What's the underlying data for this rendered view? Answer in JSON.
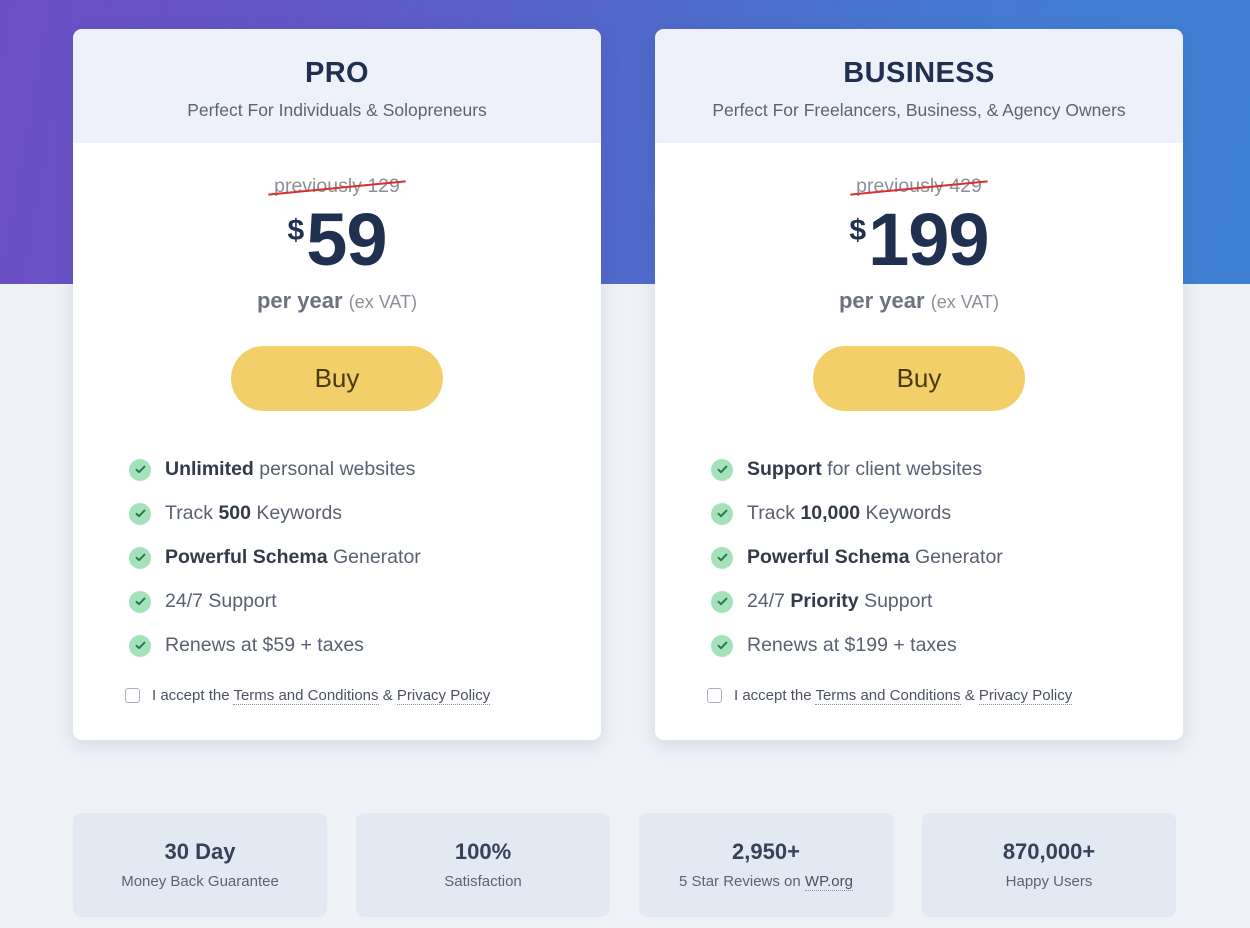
{
  "theme": {
    "gradient_start": "#6d4fc4",
    "gradient_end": "#3e81d3",
    "page_background": "#eef1f6",
    "card_header_background": "#eef1f9",
    "price_color": "#1f3050",
    "buy_button_color": "#f2cf68",
    "buy_button_text_color": "#4a3a10",
    "check_circle_color": "#a5e2bb",
    "strike_color": "#d9302c",
    "badge_background": "#e3e9f2"
  },
  "plans": [
    {
      "id": "pro",
      "title": "PRO",
      "subtitle": "Perfect For Individuals & Solopreneurs",
      "previous_price": "previously 129",
      "currency": "$",
      "amount": "59",
      "period": "per year",
      "vat_note": "(ex VAT)",
      "buy_label": "Buy",
      "features": [
        {
          "bold": "Unlimited",
          "rest": " personal websites",
          "lead": ""
        },
        {
          "lead": "Track ",
          "bold": "500",
          "rest": " Keywords"
        },
        {
          "lead": "",
          "bold": "Powerful Schema",
          "rest": " Generator"
        },
        {
          "lead": "24/7 Support",
          "bold": "",
          "rest": ""
        },
        {
          "lead": "Renews at $59 + taxes",
          "bold": "",
          "rest": ""
        }
      ],
      "accept": {
        "prefix": "I accept the ",
        "terms_link": "Terms and Conditions",
        "separator": " & ",
        "privacy_link": "Privacy Policy"
      }
    },
    {
      "id": "business",
      "title": "BUSINESS",
      "subtitle": "Perfect For Freelancers, Business, & Agency Owners",
      "previous_price": "previously 429",
      "currency": "$",
      "amount": "199",
      "period": "per year",
      "vat_note": "(ex VAT)",
      "buy_label": "Buy",
      "features": [
        {
          "lead": "",
          "bold": "Support",
          "rest": " for client websites"
        },
        {
          "lead": "Track ",
          "bold": "10,000",
          "rest": " Keywords"
        },
        {
          "lead": "",
          "bold": "Powerful Schema",
          "rest": " Generator"
        },
        {
          "lead": "24/7 ",
          "bold": "Priority",
          "rest": " Support"
        },
        {
          "lead": "Renews at $199 + taxes",
          "bold": "",
          "rest": ""
        }
      ],
      "accept": {
        "prefix": "I accept the ",
        "terms_link": "Terms and Conditions",
        "separator": " & ",
        "privacy_link": "Privacy Policy"
      }
    }
  ],
  "badges": [
    {
      "value": "30 Day",
      "label": "Money Back Guarantee",
      "link_text": ""
    },
    {
      "value": "100%",
      "label": "Satisfaction",
      "link_text": ""
    },
    {
      "value": "2,950+",
      "label_prefix": "5 Star Reviews on ",
      "link_text": "WP.org",
      "label": "5 Star Reviews on WP.org"
    },
    {
      "value": "870,000+",
      "label": "Happy Users",
      "link_text": ""
    }
  ]
}
